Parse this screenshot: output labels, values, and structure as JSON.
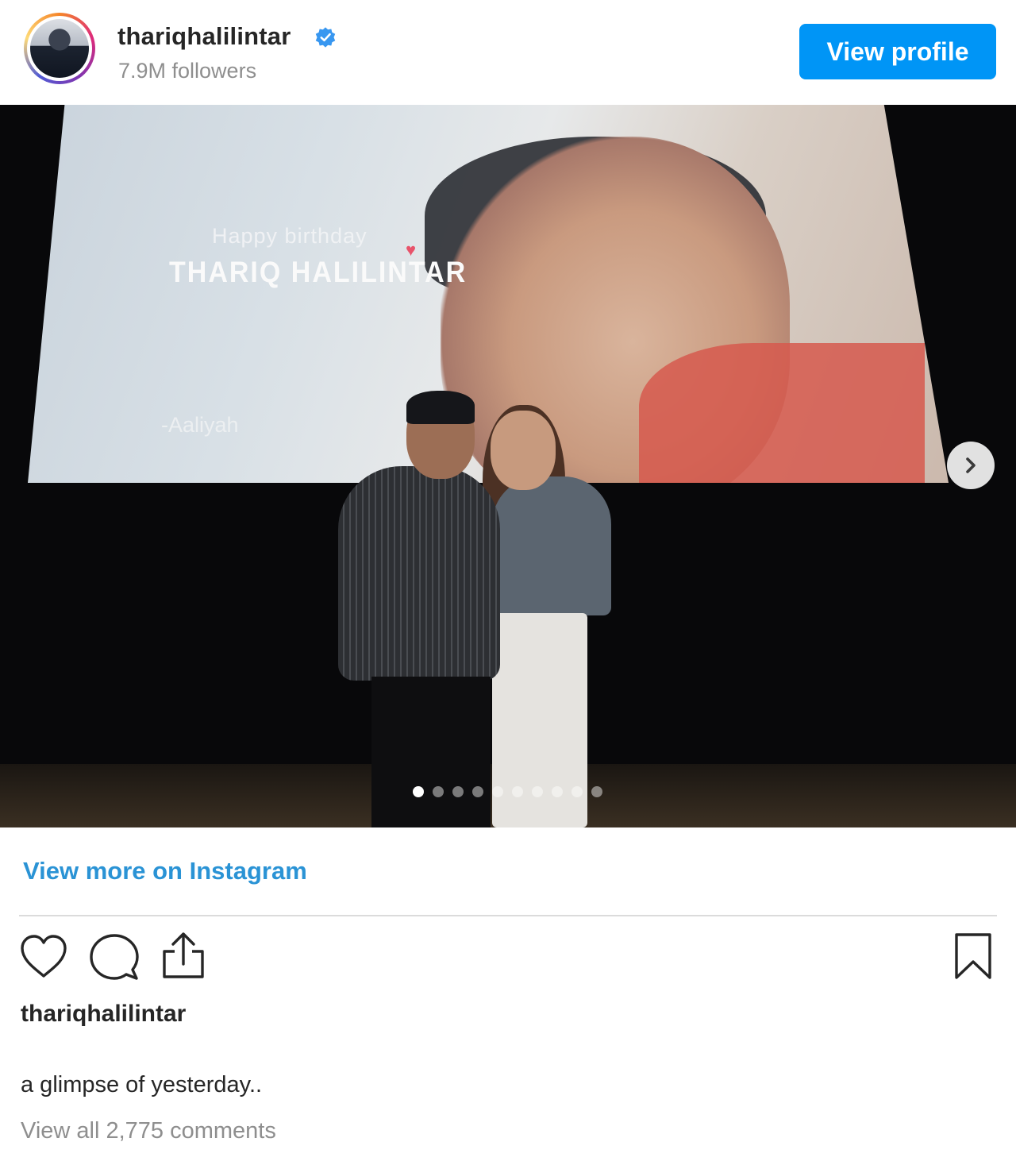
{
  "header": {
    "username": "thariqhalilintar",
    "followers": "7.9M followers",
    "view_profile_label": "View profile",
    "verified_icon": "verified-badge-icon",
    "accent_color": "#0095f6"
  },
  "post": {
    "screen_text": {
      "line1": "Happy birthday",
      "line2": "THARIQ HALILINTAR",
      "signature": "-Aaliyah"
    },
    "carousel": {
      "total_slides": 10,
      "active_slide": 1
    }
  },
  "view_more_label": "View more on Instagram",
  "actions": {
    "like_icon": "heart-icon",
    "comment_icon": "comment-icon",
    "share_icon": "share-icon",
    "save_icon": "bookmark-icon"
  },
  "caption": {
    "username": "thariqhalilintar",
    "text": "a glimpse of yesterday..",
    "comments_link": "View all 2,775 comments"
  }
}
